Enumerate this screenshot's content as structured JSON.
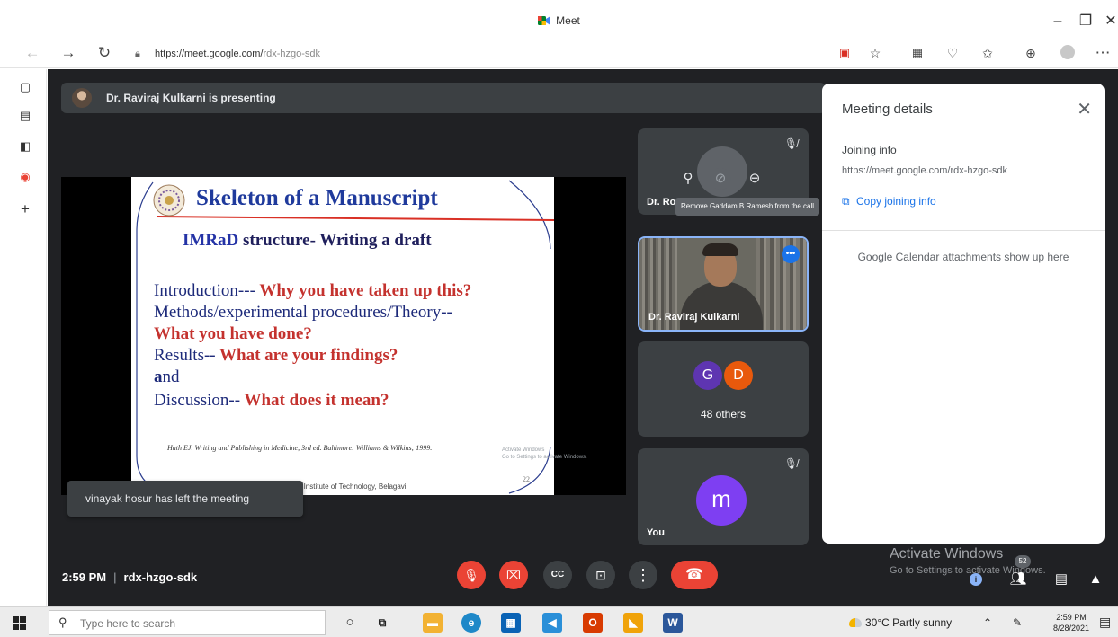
{
  "browser": {
    "tab_title": "Meet",
    "url_host": "https://meet.google.com/",
    "url_path": "rdx-hzgo-sdk"
  },
  "meet": {
    "presenting_text": "Dr. Raviraj Kulkarni is presenting",
    "slide": {
      "title": "Skeleton of a Manuscript",
      "subtitle_key": "IMRaD",
      "subtitle_rest": " structure- Writing a draft",
      "lines": [
        {
          "lead": "I",
          "plain": "ntroduction---",
          "red": " Why you have taken up this?"
        },
        {
          "lead": "M",
          "plain": "ethods/experimental procedures/Theory--",
          "red": ""
        },
        {
          "lead": "",
          "plain": "",
          "red": "What you have done?"
        },
        {
          "lead": "R",
          "plain": "esults--",
          "red": " What are your findings?"
        },
        {
          "lead": "a",
          "plain": "nd",
          "red": ""
        },
        {
          "lead": "D",
          "plain": "iscussion--",
          "red": " What does it mean?"
        }
      ],
      "reference": "Huth EJ. Writing and Publishing in Medicine, 3rd ed. Baltimore: Williams & Wilkins; 1999.",
      "footer": "S.Gogte Institute of Technology, Belagavi",
      "page_number": "22",
      "watermark_line1": "Activate Windows",
      "watermark_line2": "Go to Settings to activate Windows."
    },
    "toast": "vinayak hosur has left the meeting",
    "tiles": {
      "tile1_name": "Dr. Ro",
      "tooltip": "Remove Gaddam B Ramesh from the call",
      "tile2_name": "Dr. Raviraj Kulkarni",
      "others_initials": [
        "G",
        "D"
      ],
      "others_label": "48 others",
      "you_initial": "m",
      "you_label": "You"
    },
    "panel": {
      "title": "Meeting details",
      "joining_label": "Joining info",
      "joining_link": "https://meet.google.com/rdx-hzgo-sdk",
      "copy_label": "Copy joining info",
      "calendar_note": "Google Calendar attachments show up here"
    },
    "time": "2:59 PM",
    "meeting_code": "rdx-hzgo-sdk",
    "activate_title": "Activate Windows",
    "activate_sub": "Go to Settings to activate Windows.",
    "participant_count": "52"
  },
  "taskbar": {
    "search_placeholder": "Type here to search",
    "weather": "30°C  Partly sunny",
    "clock_time": "2:59 PM",
    "clock_date": "8/28/2021"
  },
  "colors": {
    "meet_bg": "#202124",
    "tile_bg": "#3c4043",
    "red": "#ea4335",
    "blue": "#1a73e8",
    "avatar_g": "#5e35b1",
    "avatar_d": "#e8590c",
    "avatar_m": "#7e3ff2"
  }
}
